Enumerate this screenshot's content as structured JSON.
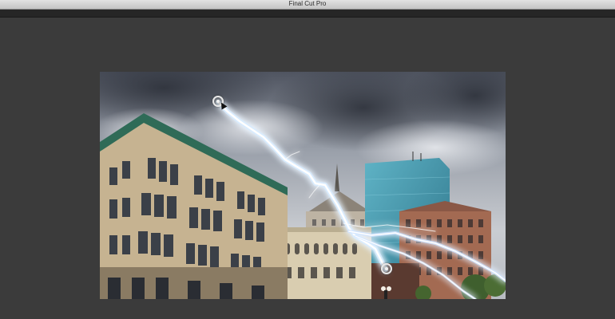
{
  "app": {
    "window_title": "Final Cut Pro"
  },
  "viewer": {
    "content": "city-lightning-image",
    "effect_handles": [
      "effect-start-handle",
      "effect-end-handle"
    ]
  },
  "colors": {
    "titlebar": "#d2d2d2",
    "background": "#3b3b3b",
    "strip": "#262626",
    "lightning": "#cfe6ff"
  }
}
